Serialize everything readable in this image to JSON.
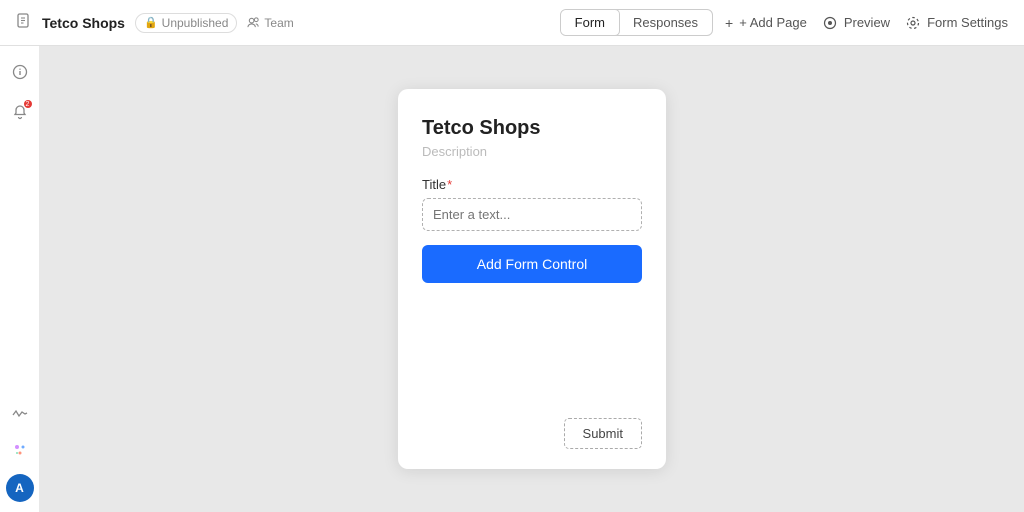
{
  "topbar": {
    "doc_icon": "📄",
    "title": "Tetco Shops",
    "status_label": "Unpublished",
    "team_label": "Team",
    "tab_form": "Form",
    "tab_responses": "Responses",
    "add_page": "+ Add Page",
    "preview": "Preview",
    "form_settings": "Form Settings"
  },
  "sidebar": {
    "info_icon": "ⓘ",
    "bell_icon": "🔔",
    "activity_icon": "〜",
    "sparkle_icon": "✦",
    "avatar_initials": "A",
    "notification_count": "2"
  },
  "form": {
    "title": "Tetco Shops",
    "description": "Description",
    "field_label": "Title",
    "field_required": "*",
    "field_placeholder": "Enter a text...",
    "add_control_label": "Add Form Control",
    "submit_label": "Submit"
  }
}
